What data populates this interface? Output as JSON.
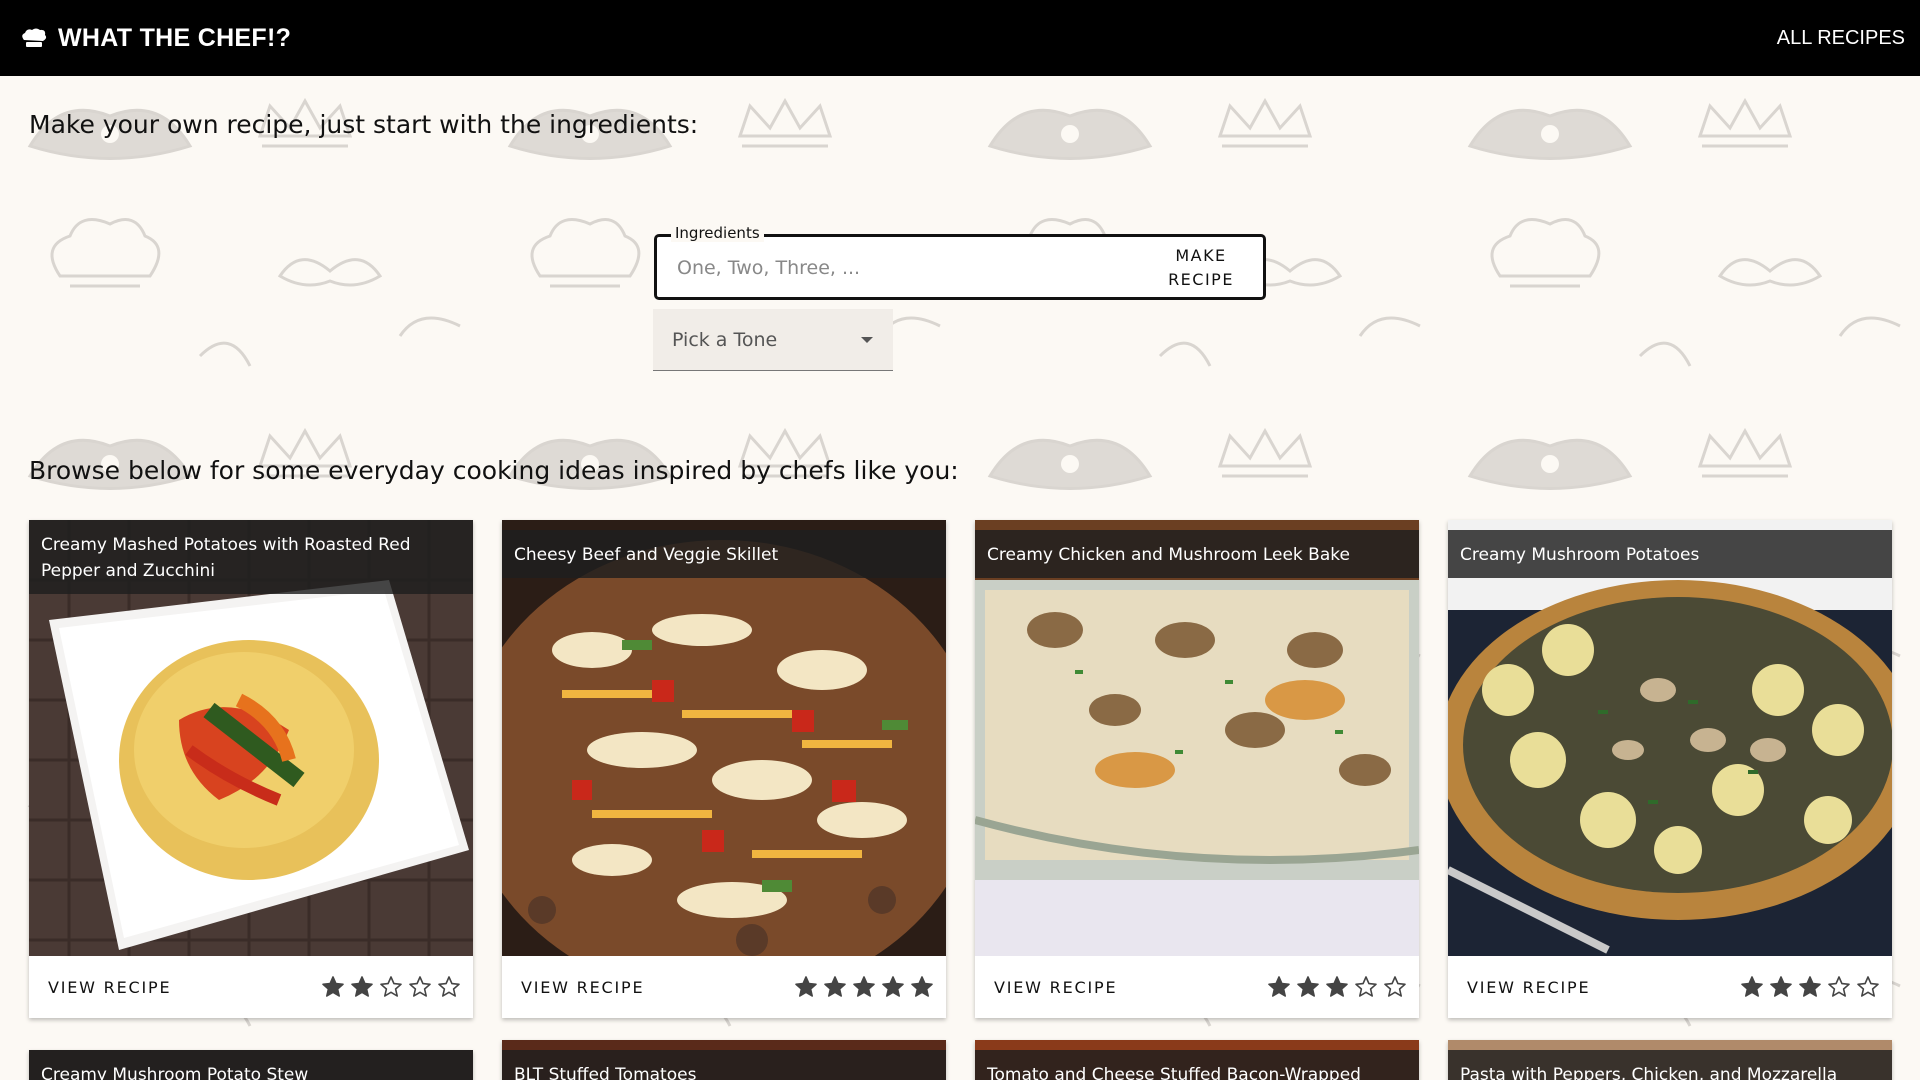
{
  "header": {
    "app_title": "WHAT THE CHEF!?",
    "nav_all_recipes": "ALL RECIPES",
    "logo_icon": "chef-hat-icon"
  },
  "make_recipe": {
    "intro": "Make your own recipe, just start with the ingredients:",
    "ingredients_label": "Ingredients",
    "ingredients_placeholder": "One, Two, Three, ...",
    "ingredients_value": "",
    "make_button": "MAKE RECIPE",
    "tone_placeholder": "Pick a Tone"
  },
  "browse": {
    "heading": "Browse below for some everyday cooking ideas inspired by chefs like you:",
    "view_label": "VIEW RECIPE",
    "recipes": [
      {
        "title": "Creamy Mashed Potatoes with Roasted Red Pepper and Zucchini",
        "rating": 2
      },
      {
        "title": "Cheesy Beef and Veggie Skillet",
        "rating": 5
      },
      {
        "title": "Creamy Chicken and Mushroom Leek Bake",
        "rating": 3
      },
      {
        "title": "Creamy Mushroom Potatoes",
        "rating": 3
      }
    ],
    "recipes_row2": [
      {
        "title": "Creamy Mushroom Potato Stew"
      },
      {
        "title": "BLT Stuffed Tomatoes"
      },
      {
        "title": "Tomato and Cheese Stuffed Bacon-Wrapped"
      },
      {
        "title": "Pasta with Peppers, Chicken, and Mozzarella"
      }
    ]
  },
  "colors": {
    "topbar": "#000000",
    "background": "#fcf9f4",
    "pattern": "#d9d5d0",
    "title_overlay": "#1e1e1e"
  }
}
